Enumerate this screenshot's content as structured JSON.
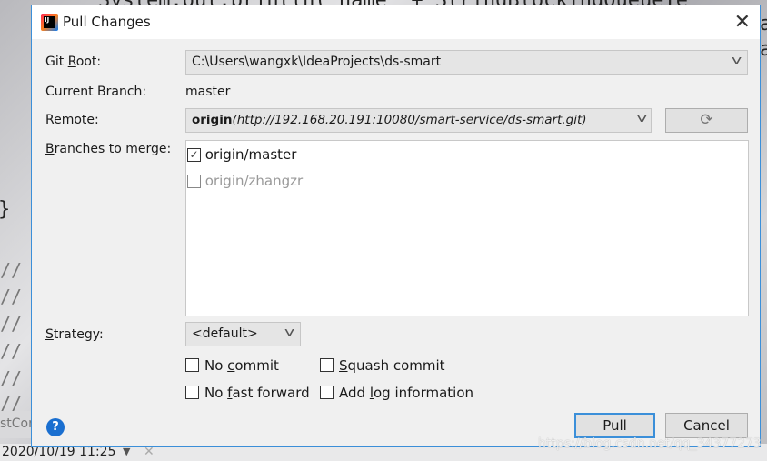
{
  "background": {
    "code_line_top": "System.out.println(\"name\" + StringBlockingQueueTe",
    "code_right_1": "a",
    "code_right_2": "a",
    "code_brace": "}",
    "comment_slashes": [
      "//",
      "//",
      "//",
      "//",
      "//",
      "//"
    ],
    "tab_stub": "stCor",
    "status_date": "2020/10/19 11:25",
    "watermark": "https://blog.csdn.net/qq_34377273"
  },
  "dialog": {
    "title": "Pull Changes",
    "git_root": {
      "pre": "Git ",
      "key": "R",
      "post": "oot:",
      "value": "C:\\Users\\wangxk\\IdeaProjects\\ds-smart"
    },
    "current_branch": {
      "label": "Current Branch:",
      "value": "master"
    },
    "remote": {
      "pre": "Re",
      "key": "m",
      "post": "ote:",
      "name": "origin",
      "url": "(http://192.168.20.191:10080/smart-service/ds-smart.git)"
    },
    "branches": {
      "pre": "",
      "key": "B",
      "post": "ranches to merge:",
      "items": [
        {
          "label": "origin/master",
          "checked": true
        },
        {
          "label": "origin/zhangzr",
          "checked": false
        }
      ]
    },
    "strategy": {
      "pre": "",
      "key": "S",
      "post": "trategy:",
      "value": "<default>"
    },
    "options": {
      "no_commit": {
        "pre": "No ",
        "key": "c",
        "post": "ommit",
        "checked": false
      },
      "squash_commit": {
        "pre": "",
        "key": "S",
        "post": "quash commit",
        "checked": false
      },
      "no_fast_forward": {
        "pre": "No ",
        "key": "f",
        "post": "ast forward",
        "checked": false
      },
      "add_log": {
        "pre": "Add ",
        "key": "l",
        "post": "og information",
        "checked": false
      }
    },
    "buttons": {
      "pull": "Pull",
      "cancel": "Cancel",
      "help": "?"
    },
    "colors": {
      "accent": "#3b8fd9",
      "help": "#1a6fd0"
    }
  }
}
